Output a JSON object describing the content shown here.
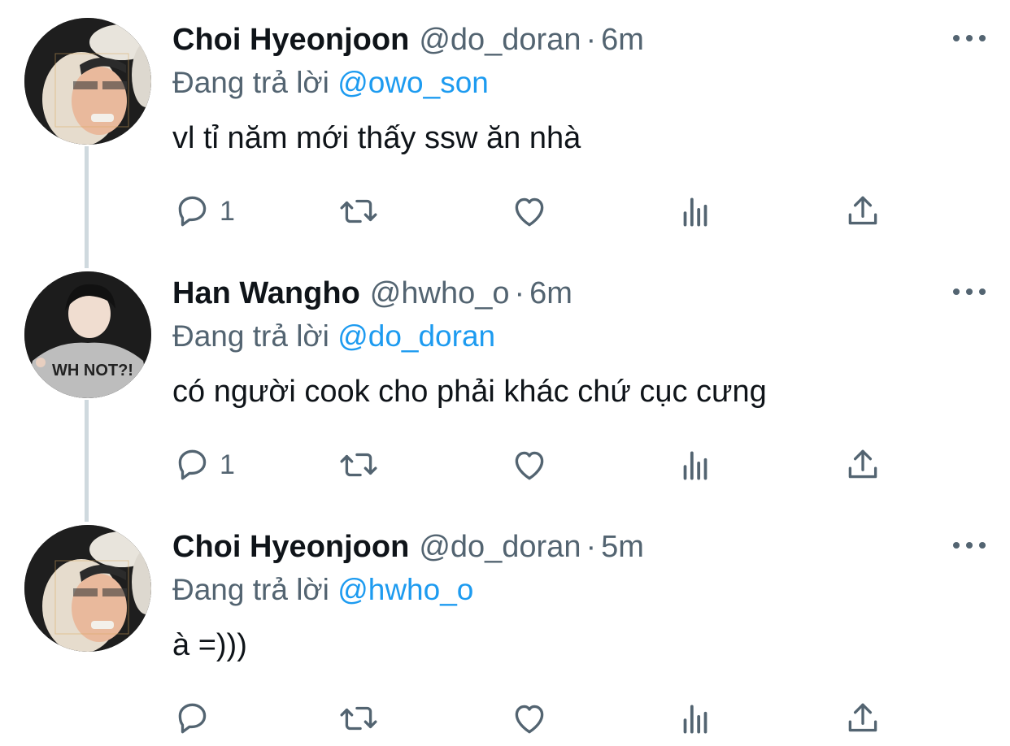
{
  "tweets": [
    {
      "name": "Choi Hyeonjoon",
      "handle": "@do_doran",
      "separator": "·",
      "time": "6m",
      "replying_prefix": "Đang trả lời",
      "replying_to": "@owo_son",
      "text": "vl tỉ năm mới thấy ssw ăn nhà",
      "reply_count": "1",
      "avatar": "profile-photo-choi"
    },
    {
      "name": "Han Wangho",
      "handle": "@hwho_o",
      "separator": "·",
      "time": "6m",
      "replying_prefix": "Đang trả lời",
      "replying_to": "@do_doran",
      "text": "có người cook cho phải khác chứ cục cưng",
      "reply_count": "1",
      "avatar": "profile-photo-han"
    },
    {
      "name": "Choi Hyeonjoon",
      "handle": "@do_doran",
      "separator": "·",
      "time": "5m",
      "replying_prefix": "Đang trả lời",
      "replying_to": "@hwho_o",
      "text": "à =)))",
      "reply_count": "",
      "avatar": "profile-photo-choi"
    }
  ],
  "icons": {
    "reply": "speech-bubble-icon",
    "retweet": "retweet-arrows-icon",
    "like": "heart-icon",
    "views": "bar-chart-icon",
    "share": "upload-arrow-icon",
    "more": "three-dots-icon"
  },
  "colors": {
    "text": "#0f1419",
    "secondary": "#536471",
    "mention": "#1d9bf0",
    "thread_line": "#cfd9de"
  }
}
